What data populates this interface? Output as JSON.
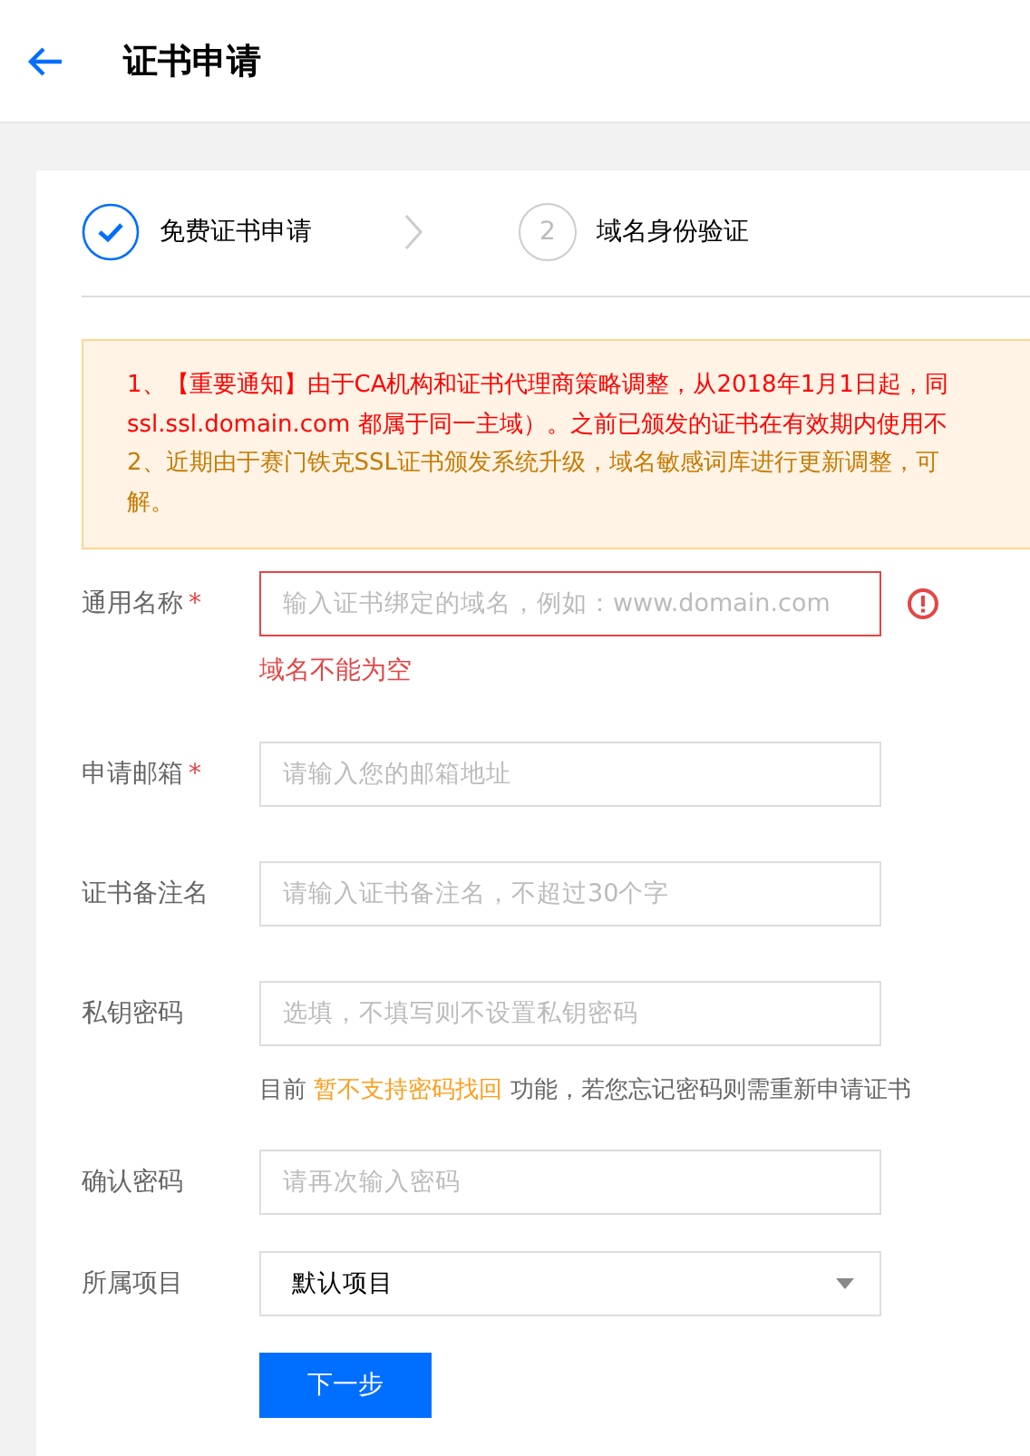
{
  "header": {
    "title": "证书申请"
  },
  "steps": [
    {
      "label": "免费证书申请",
      "done": true
    },
    {
      "label": "域名身份验证",
      "done": false,
      "number": "2"
    }
  ],
  "notices": [
    {
      "important": true,
      "lines": [
        "1、【重要通知】由于CA机构和证书代理商策略调整，从2018年1月1日起，同",
        "ssl.ssl.domain.com 都属于同一主域）。之前已颁发的证书在有效期内使用不"
      ]
    },
    {
      "important": false,
      "lines": [
        "2、近期由于赛门铁克SSL证书颁发系统升级，域名敏感词库进行更新调整，可",
        "解。"
      ]
    }
  ],
  "fields": [
    {
      "kind": "text",
      "label": "通用名称",
      "marker": "*",
      "placeholder": "输入证书绑定的域名，例如：www.domain.com",
      "error": true,
      "error_message": "域名不能为空"
    },
    {
      "kind": "text",
      "label": "申请邮箱",
      "marker": "*",
      "placeholder": "请输入您的邮箱地址",
      "error": false
    },
    {
      "kind": "text",
      "label": "证书备注名",
      "placeholder": "请输入证书备注名，不超过30个字",
      "error": false
    },
    {
      "kind": "text",
      "label": "私钥密码",
      "placeholder": "选填，不填写则不设置私钥密码",
      "error": false,
      "hint": {
        "before": "目前",
        "highlight": "暂不支持密码找回",
        "after": "功能，若您忘记密码则需重新申请证书"
      }
    },
    {
      "kind": "text",
      "label": "确认密码",
      "placeholder": "请再次输入密码",
      "error": false
    },
    {
      "kind": "select",
      "label": "所属项目",
      "value": "默认项目"
    }
  ],
  "submit": {
    "label": "下一步"
  }
}
